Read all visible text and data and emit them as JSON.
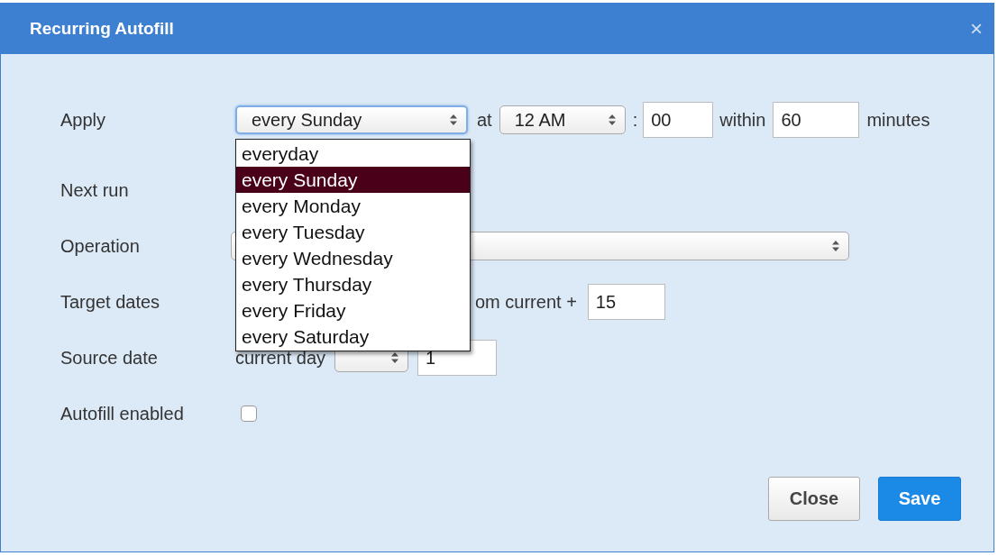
{
  "window": {
    "title": "Recurring Autofill",
    "close": "×"
  },
  "apply": {
    "label": "Apply",
    "value": "every Sunday",
    "at": "at",
    "hour": "12 AM",
    "colon": ":",
    "minute": "00",
    "within": "within",
    "duration": "60",
    "unit": "minutes"
  },
  "dropdown": [
    {
      "label": "everyday",
      "selected": false
    },
    {
      "label": "every Sunday",
      "selected": true
    },
    {
      "label": "every Monday",
      "selected": false
    },
    {
      "label": "every Tuesday",
      "selected": false
    },
    {
      "label": "every Wednesday",
      "selected": false
    },
    {
      "label": "every Thursday",
      "selected": false
    },
    {
      "label": "every Friday",
      "selected": false
    },
    {
      "label": "every Saturday",
      "selected": false
    }
  ],
  "next_run": {
    "label": "Next run"
  },
  "operation": {
    "label": "Operation"
  },
  "target_dates": {
    "label": "Target dates",
    "text": "om current +",
    "value": "15"
  },
  "source_date": {
    "label": "Source date",
    "text": "current day",
    "value": "1"
  },
  "autofill_enabled": {
    "label": "Autofill enabled",
    "checked": false
  },
  "buttons": [
    {
      "label": "Close",
      "kind": "secondary"
    },
    {
      "label": "Save",
      "kind": "primary"
    }
  ]
}
